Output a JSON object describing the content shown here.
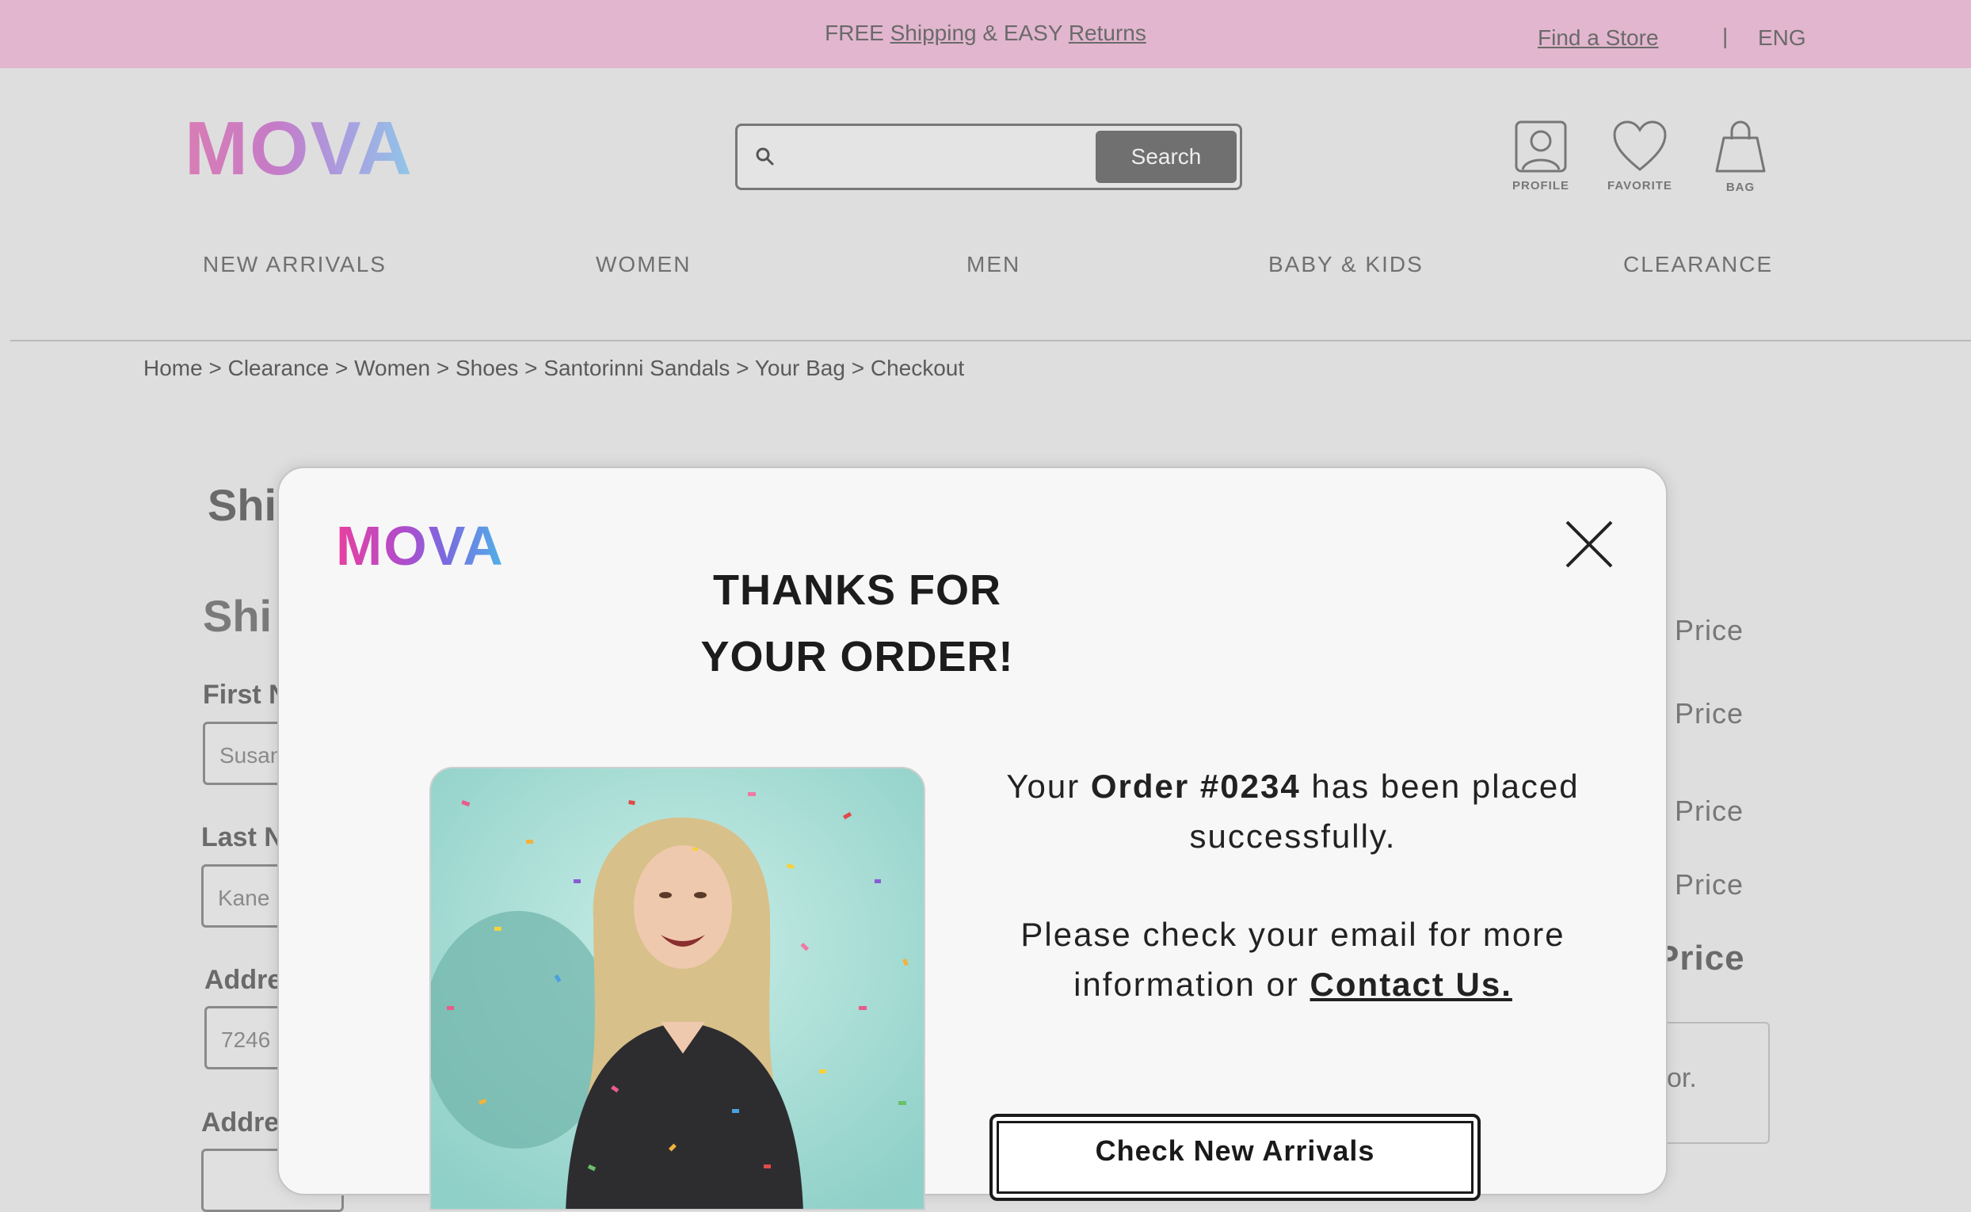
{
  "promo": {
    "free_text": "FREE",
    "shipping_link": "Shipping",
    "and_easy_text": "& EASY",
    "returns_link": "Returns",
    "find_store": "Find a Store",
    "separator": "|",
    "language": "ENG"
  },
  "header": {
    "logo": "MOVA",
    "search": {
      "placeholder": "",
      "button_label": "Search"
    },
    "icons": [
      {
        "name": "profile-icon",
        "label": "PROFILE"
      },
      {
        "name": "heart-icon",
        "label": "FAVORITE"
      },
      {
        "name": "bag-icon",
        "label": "BAG"
      }
    ]
  },
  "nav": [
    "NEW ARRIVALS",
    "WOMEN",
    "MEN",
    "BABY & KIDS",
    "CLEARANCE"
  ],
  "breadcrumb": "Home > Clearance > Women > Shoes > Santorinni Sandals > Your Bag > Checkout",
  "checkout_bg": {
    "heading1": "Shi",
    "heading2": "Shi",
    "fields": [
      {
        "label": "First N",
        "value": "Susan"
      },
      {
        "label": "Last N",
        "value": "Kane"
      },
      {
        "label": "Addre",
        "value": "7246"
      },
      {
        "label": "Addre",
        "value": ""
      }
    ],
    "prices": [
      ") Price",
      ") Price",
      ") Price",
      ") Price"
    ],
    "total_price": "Price",
    "side_box_text": "or."
  },
  "modal": {
    "logo": "MOVA",
    "title": "THANKS FOR YOUR ORDER!",
    "msg_prefix": "Your",
    "order_number": "Order #0234",
    "msg_suffix": "has been placed successfully.",
    "msg2_prefix": "Please check your email for more information or",
    "contact_link": "Contact Us.",
    "cta_label": "Check New Arrivals"
  }
}
